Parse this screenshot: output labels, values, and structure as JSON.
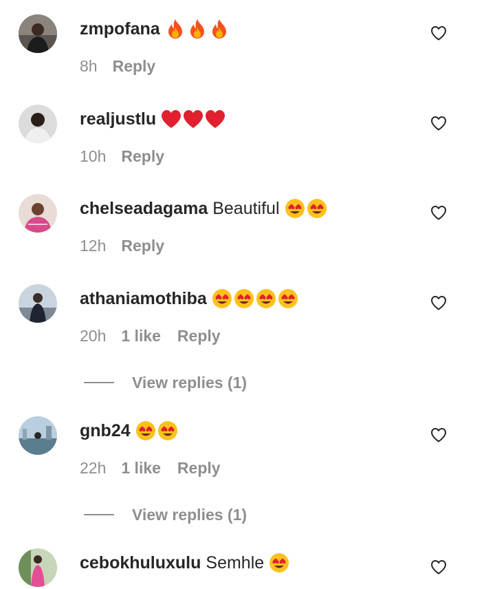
{
  "comments": [
    {
      "username": "zmpofana",
      "text": "",
      "emojis": [
        "fire",
        "fire",
        "fire"
      ],
      "time": "8h",
      "likes": "",
      "reply": "Reply",
      "view_replies": ""
    },
    {
      "username": "realjustlu",
      "text": "",
      "emojis": [
        "red-heart",
        "red-heart",
        "red-heart"
      ],
      "time": "10h",
      "likes": "",
      "reply": "Reply",
      "view_replies": ""
    },
    {
      "username": "chelseadagama",
      "text": "Beautiful",
      "emojis": [
        "heart-eyes",
        "heart-eyes"
      ],
      "time": "12h",
      "likes": "",
      "reply": "Reply",
      "view_replies": ""
    },
    {
      "username": "athaniamothiba",
      "text": "",
      "emojis": [
        "heart-eyes",
        "heart-eyes",
        "heart-eyes",
        "heart-eyes"
      ],
      "time": "20h",
      "likes": "1 like",
      "reply": "Reply",
      "view_replies": "View replies (1)"
    },
    {
      "username": "gnb24",
      "text": "",
      "emojis": [
        "heart-eyes",
        "heart-eyes"
      ],
      "time": "22h",
      "likes": "1 like",
      "reply": "Reply",
      "view_replies": "View replies (1)"
    },
    {
      "username": "cebokhuluxulu",
      "text": "Semhle",
      "emojis": [
        "heart-eyes"
      ],
      "time": "",
      "likes": "",
      "reply": "",
      "view_replies": ""
    }
  ],
  "icons": {
    "like_button": "heart-outline-icon",
    "avatar": "avatar-photo"
  },
  "colors": {
    "username": "#262626",
    "secondary": "#8e8e8e",
    "background": "#ffffff"
  }
}
